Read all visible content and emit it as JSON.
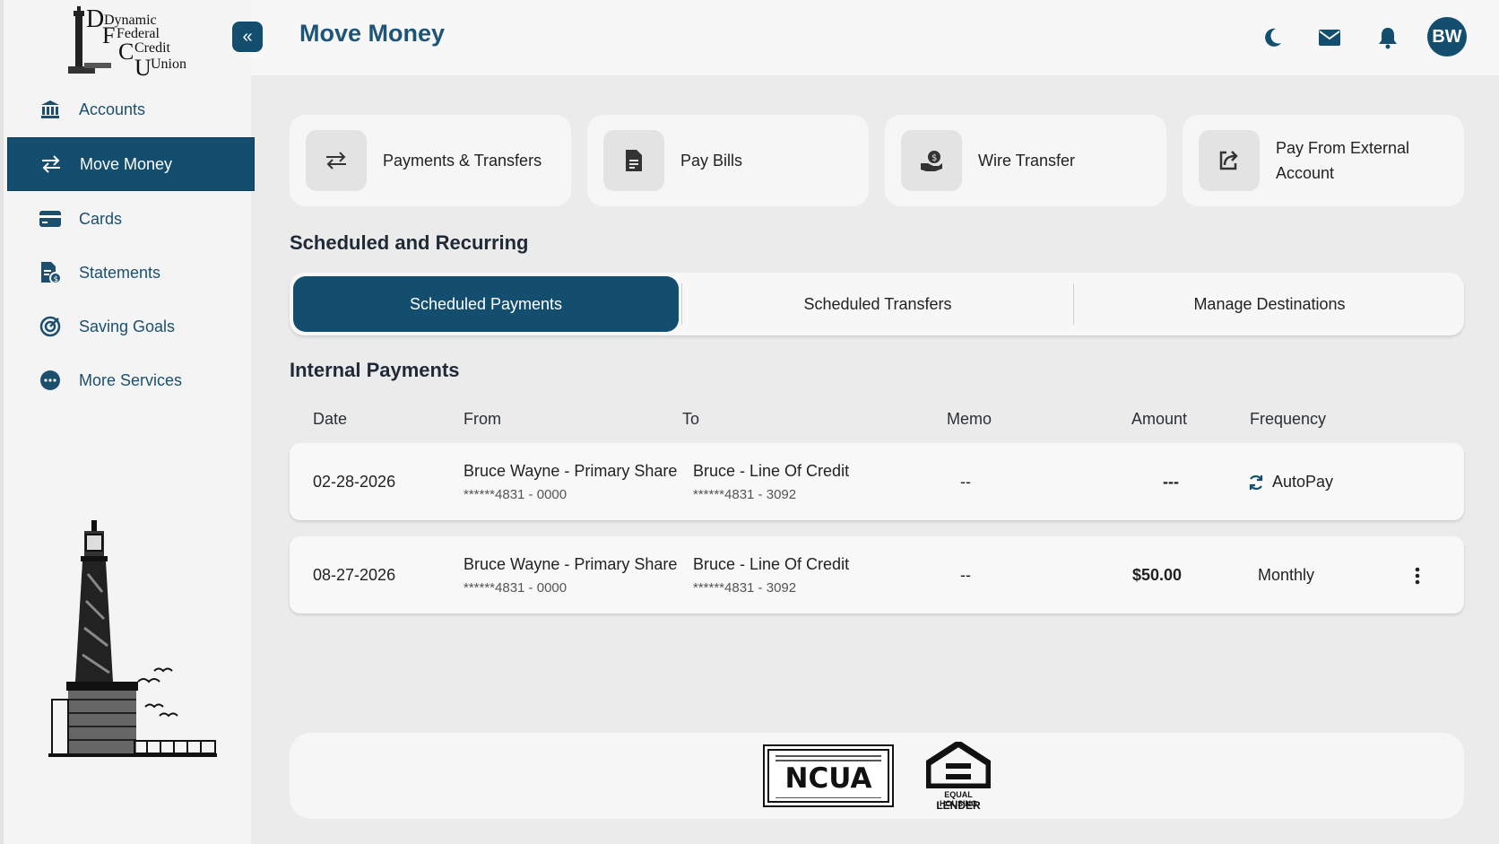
{
  "brand": {
    "line1": "Dynamic",
    "line2": "Federal",
    "line3": "Credit",
    "line4": "Union"
  },
  "sidebar": {
    "items": [
      {
        "label": "Accounts",
        "icon": "bank-icon"
      },
      {
        "label": "Move Money",
        "icon": "transfer-icon",
        "active": true
      },
      {
        "label": "Cards",
        "icon": "card-icon"
      },
      {
        "label": "Statements",
        "icon": "statement-icon"
      },
      {
        "label": "Saving Goals",
        "icon": "target-icon"
      },
      {
        "label": "More Services",
        "icon": "more-icon"
      }
    ]
  },
  "header": {
    "title": "Move Money",
    "avatar_initials": "BW",
    "icons": [
      "moon-icon",
      "mail-icon",
      "bell-icon"
    ]
  },
  "quick_actions": [
    {
      "label": "Payments & Transfers",
      "icon": "arrows-icon"
    },
    {
      "label": "Pay Bills",
      "icon": "document-icon"
    },
    {
      "label": "Wire Transfer",
      "icon": "money-hand-icon"
    },
    {
      "label_line1": "Pay From External",
      "label_line2": "Account",
      "icon": "external-share-icon"
    }
  ],
  "scheduled": {
    "title": "Scheduled and Recurring",
    "tabs": [
      "Scheduled Payments",
      "Scheduled Transfers",
      "Manage Destinations"
    ]
  },
  "internal": {
    "title": "Internal Payments",
    "columns": [
      "Date",
      "From",
      "To",
      "Memo",
      "Amount",
      "Frequency"
    ],
    "rows": [
      {
        "date": "02-28-2026",
        "from": "Bruce Wayne - Primary Share",
        "from_acct": "******4831 - 0000",
        "to": "Bruce - Line Of Credit",
        "to_acct": "******4831 - 3092",
        "memo": "--",
        "amount": "---",
        "frequency": "AutoPay"
      },
      {
        "date": "08-27-2026",
        "from": "Bruce Wayne - Primary Share",
        "from_acct": "******4831 - 0000",
        "to": "Bruce - Line Of Credit",
        "to_acct": "******4831 - 3092",
        "memo": "--",
        "amount": "$50.00",
        "frequency": "Monthly"
      }
    ]
  },
  "footer": {
    "ncua": "NCUA",
    "ehl_line1": "EQUAL HOUSING",
    "ehl_line2": "LENDER"
  },
  "colors": {
    "primary": "#134e6f",
    "title": "#1c5578",
    "background": "#ebebeb"
  }
}
